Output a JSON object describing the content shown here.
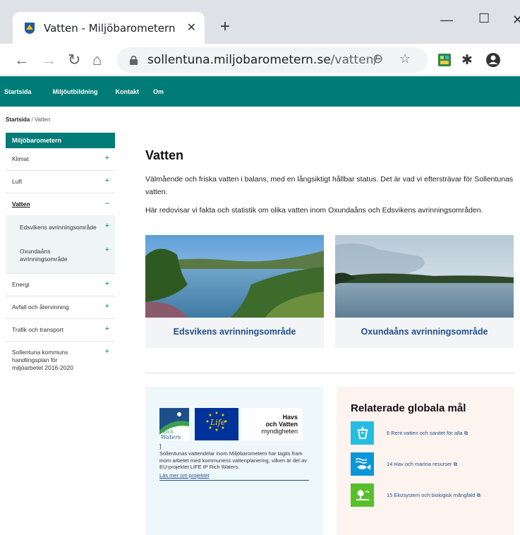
{
  "browser": {
    "tab_title": "Vatten - Miljöbarometern Sollent",
    "url_domain": "sollentuna.miljobarometern.se",
    "url_path": "/vatten/"
  },
  "nav": {
    "items": [
      "Startsida",
      "Miljöutbildning",
      "Kontakt",
      "Om"
    ]
  },
  "breadcrumb": {
    "home": "Startsida",
    "separator": " / ",
    "current": "Vatten"
  },
  "sidebar": {
    "header": "Miljöbarometern",
    "items": [
      {
        "label": "Klimat",
        "toggle": "+"
      },
      {
        "label": "Luft",
        "toggle": "+"
      },
      {
        "label": "Vatten",
        "toggle": "–"
      },
      {
        "label": "Energi",
        "toggle": "+"
      },
      {
        "label": "Avfall och återvinning",
        "toggle": "+"
      },
      {
        "label": "Trafik och transport",
        "toggle": "+"
      },
      {
        "label": "Sollentuna kommuns handlingsplan för miljöarbetet 2016-2020",
        "toggle": "+"
      }
    ],
    "subitems": [
      {
        "label": "Edsvikens avrinningsområde",
        "toggle": "+"
      },
      {
        "label": "Oxundaåns avrinningsområde",
        "toggle": "+"
      }
    ]
  },
  "main": {
    "title": "Vatten",
    "intro1": "Välmående och friska vatten i balans, med en långsiktigt hållbar status. Det är vad vi eftersträvar för Sollentunas vatten.",
    "intro2": "Här redovisar vi fakta och statistik om olika vatten inom Oxundaåns och Edsvikens avrinningsområden."
  },
  "cards": [
    {
      "label": "Edsvikens avrinningsområde"
    },
    {
      "label": "Oxundaåns avrinningsområde"
    }
  ],
  "project": {
    "rw_logo_text_1": "Rich",
    "rw_logo_text_2": "Waters",
    "life_logo_text": "Life",
    "havs_line1": "Havs",
    "havs_line2": "och Vatten",
    "havs_line3": "myndigheten",
    "bracket": "]",
    "text": "Sollentunas vattendelar inom Miljöbarometern har tagits fram inom arbetet med kommunens vattenplanering, vilken är del av EU-projektet LIFE IP Rich Waters.",
    "link": "Läs mer om projektet"
  },
  "goals": {
    "title": "Relaterade globala mål",
    "items": [
      {
        "label": "6 Rent vatten och sanitet för alla",
        "color": "#26bde2"
      },
      {
        "label": "14 Hav och marina resurser",
        "color": "#0a97d9"
      },
      {
        "label": "15 Ekosystem och biologisk mångfald",
        "color": "#56c02b"
      }
    ],
    "external_link_icon": "external-link-icon"
  },
  "colors": {
    "brand": "#007c78",
    "link": "#1f4f8a"
  }
}
